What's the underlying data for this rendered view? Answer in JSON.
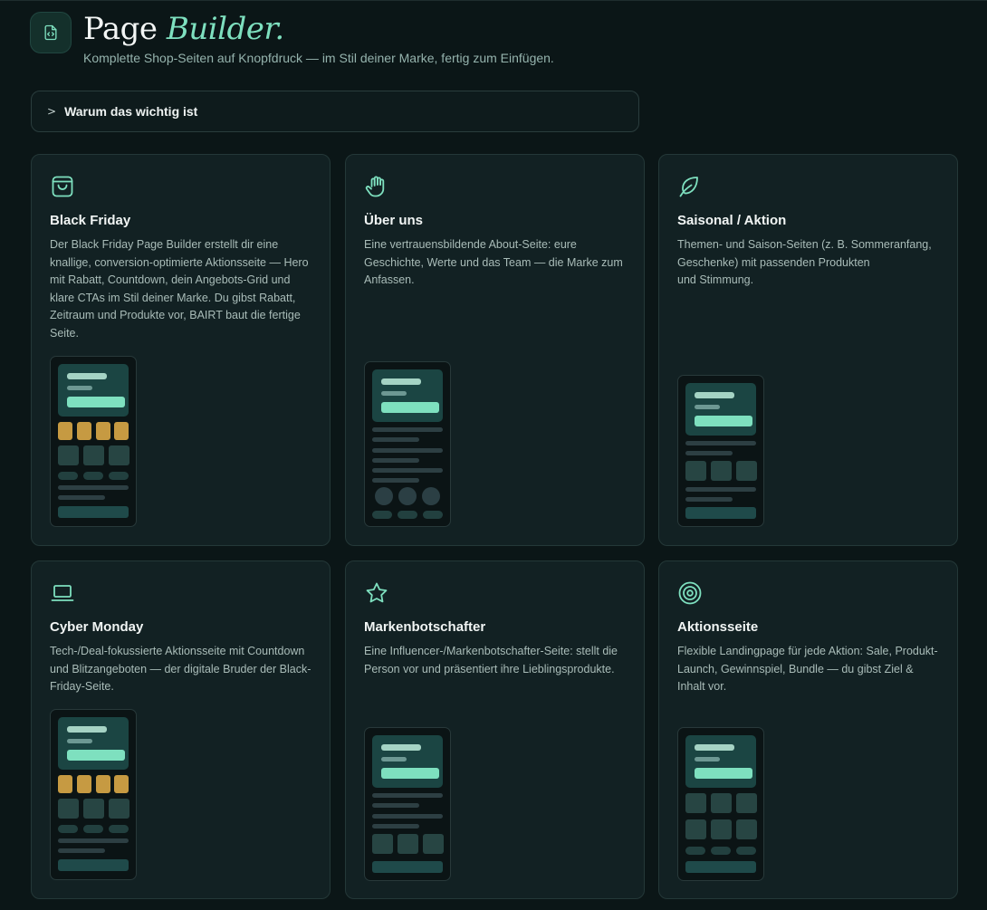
{
  "header": {
    "title_main": "Page",
    "title_accent": "Builder.",
    "subtitle": "Komplette Shop-Seiten auf Knopfdruck — im Stil deiner Marke, fertig zum Einfügen.",
    "logo_icon": "code-file-icon"
  },
  "collapsible": {
    "label": "Warum das wichtig ist",
    "icon": "chevron-right-icon",
    "chevron_glyph": ">"
  },
  "colors": {
    "background": "#0b1617",
    "card": "#122123",
    "accent": "#7ee0bf",
    "gold": "#c69a42"
  },
  "cards": [
    {
      "icon": "shopping-bag-icon",
      "title": "Black Friday",
      "description": "Der Black Friday Page Builder erstellt dir eine knallige, conversion-optimierte Aktionsseite — Hero mit Rabatt, Countdown, dein Angebots-Grid und klare CTAs im Stil deiner Marke. Du gibst Rabatt, Zeitraum und Produkte vor, BAIRT baut die fertige Seite."
    },
    {
      "icon": "hand-icon",
      "title": "Über uns",
      "description": "Eine vertrauensbildende About-Seite: eure Geschichte, Werte und das Team — die Marke zum Anfassen."
    },
    {
      "icon": "leaf-icon",
      "title": "Saisonal / Aktion",
      "description": "Themen- und Saison-Seiten (z. B. Sommeranfang, Geschenke) mit passenden Produkten\nund Stimmung."
    },
    {
      "icon": "laptop-icon",
      "title": "Cyber Monday",
      "description": "Tech-/Deal-fokussierte Aktionsseite mit Countdown und Blitzangeboten — der digitale Bruder der Black-Friday-Seite."
    },
    {
      "icon": "star-icon",
      "title": "Markenbotschafter",
      "description": "Eine Influencer-/Markenbotschafter-Seite: stellt die Person vor und präsentiert ihre Lieblingsprodukte."
    },
    {
      "icon": "target-icon",
      "title": "Aktionsseite",
      "description": "Flexible Landingpage für jede Aktion: Sale, Produkt-Launch, Gewinnspiel, Bundle — du gibst Ziel & Inhalt vor."
    }
  ]
}
